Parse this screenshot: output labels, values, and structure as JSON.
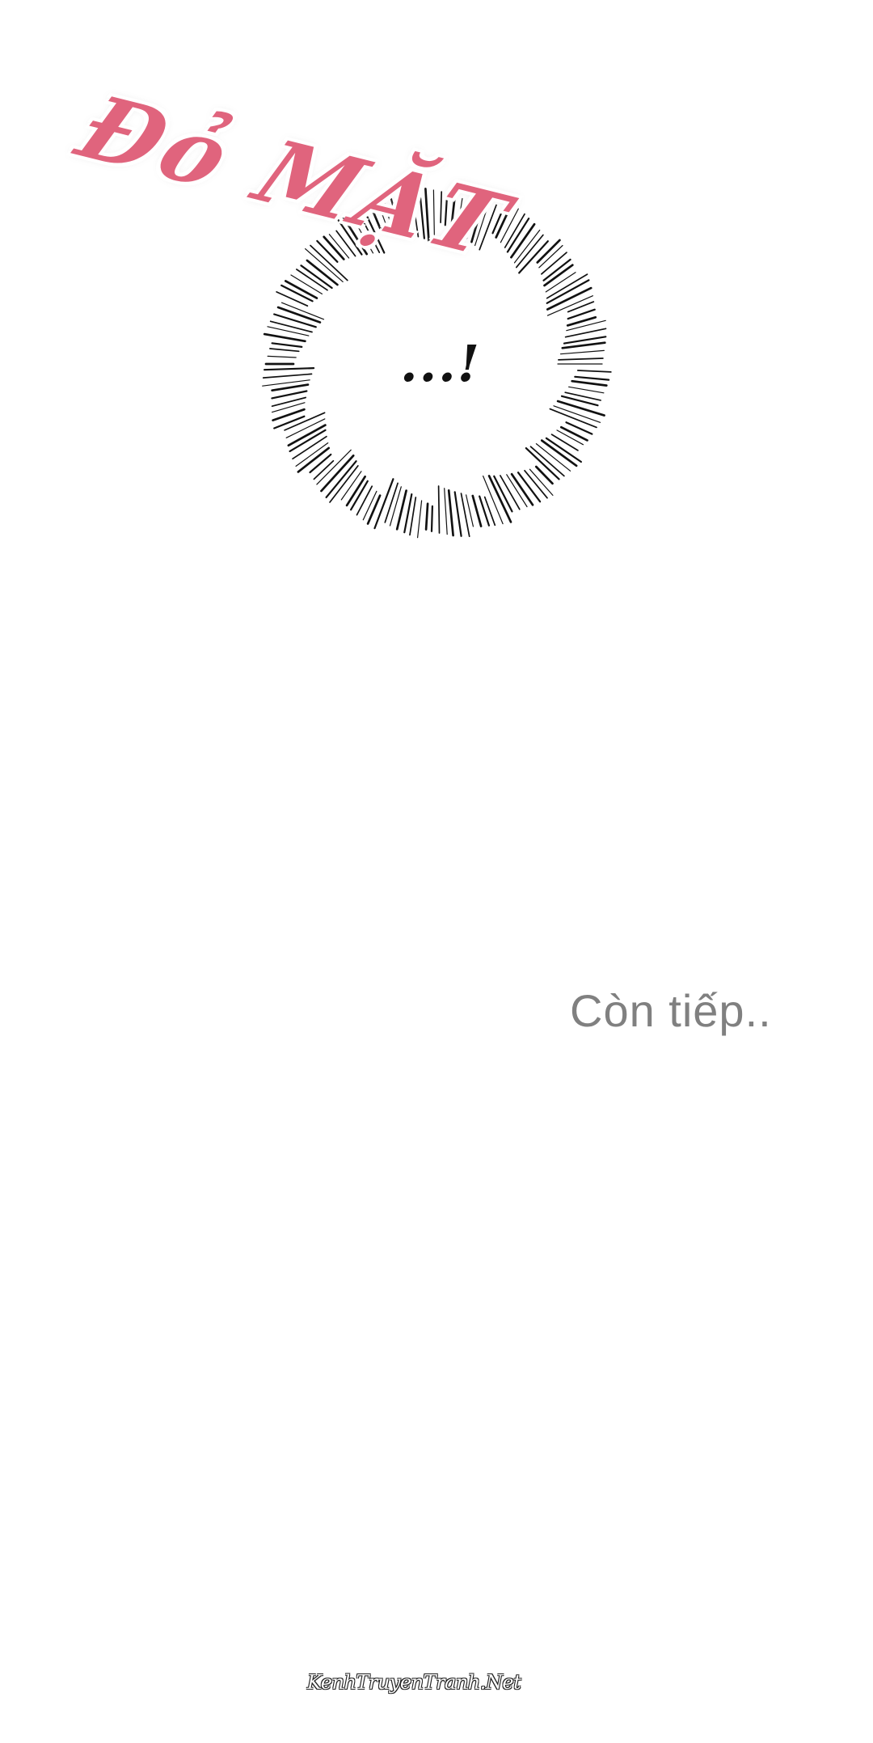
{
  "panel": {
    "sfx_text": "Đỏ MẶT",
    "sfx_color": "#e0647d",
    "speech": "...!",
    "continue_text": "Còn tiếp..",
    "continue_color": "#808080",
    "watermark": "KenhTruyenTranh.Net"
  }
}
